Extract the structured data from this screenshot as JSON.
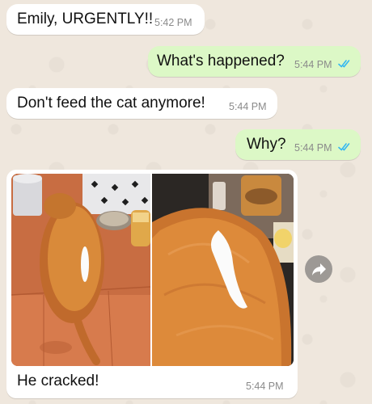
{
  "messages": [
    {
      "direction": "in",
      "text": "Emily, URGENTLY!!",
      "time": "5:42 PM"
    },
    {
      "direction": "out",
      "text": "What's happened?",
      "time": "5:44 PM",
      "status_icon": "double-check-read-icon"
    },
    {
      "direction": "in",
      "text": "Don't feed the cat anymore!",
      "time": "5:44 PM"
    },
    {
      "direction": "out",
      "text": "Why?",
      "time": "5:44 PM",
      "status_icon": "double-check-read-icon"
    },
    {
      "direction": "in",
      "type": "image",
      "caption": "He cracked!",
      "time": "5:44 PM",
      "forward_icon": "share-arrow-icon"
    }
  ],
  "colors": {
    "chat_background": "#efe7dd",
    "incoming_bubble": "#ffffff",
    "outgoing_bubble": "#dcf8c6",
    "read_ticks": "#34b7f1",
    "timestamp": "#8a8a8a"
  }
}
